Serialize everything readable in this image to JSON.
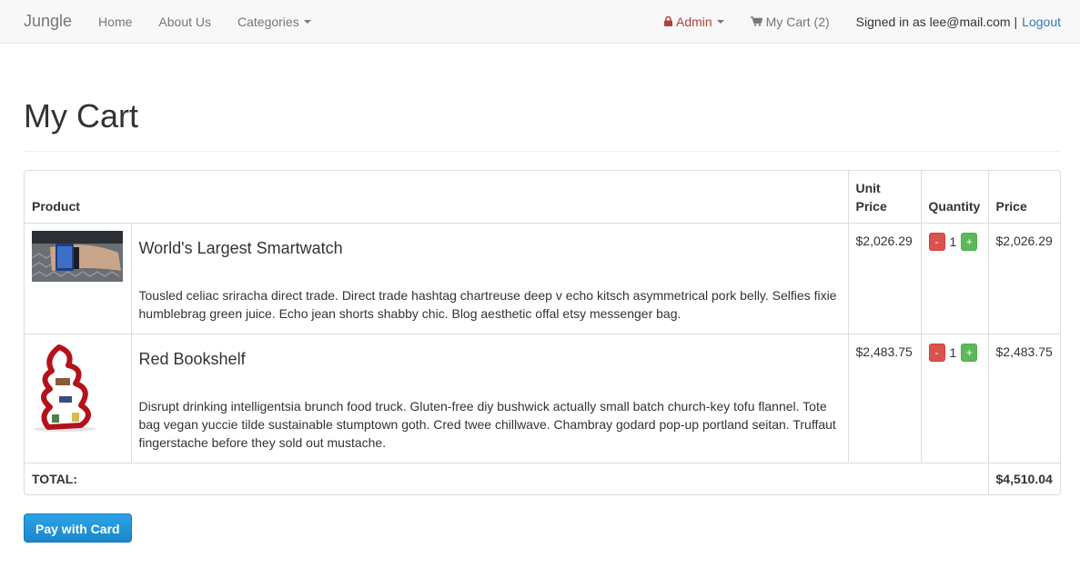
{
  "nav": {
    "brand": "Jungle",
    "home": "Home",
    "about": "About Us",
    "categories": "Categories",
    "admin": "Admin",
    "cart": "My Cart (2)",
    "signed_in": "Signed in as lee@mail.com",
    "separator": "|",
    "logout": "Logout"
  },
  "page": {
    "title": "My Cart"
  },
  "table": {
    "headers": {
      "product": "Product",
      "unit_price": "Unit Price",
      "quantity": "Quantity",
      "price": "Price"
    },
    "items": [
      {
        "name": "World's Largest Smartwatch",
        "description": "Tousled celiac sriracha direct trade. Direct trade hashtag chartreuse deep v echo kitsch asymmetrical pork belly. Selfies fixie humblebrag green juice. Echo jean shorts shabby chic. Blog aesthetic offal etsy messenger bag.",
        "unit_price": "$2,026.29",
        "quantity": "1",
        "price": "$2,026.29",
        "minus": "-",
        "plus": "+"
      },
      {
        "name": "Red Bookshelf",
        "description": "Disrupt drinking intelligentsia brunch food truck. Gluten-free diy bushwick actually small batch church-key tofu flannel. Tote bag vegan yuccie tilde sustainable stumptown goth. Cred twee chillwave. Chambray godard pop-up portland seitan. Truffaut fingerstache before they sold out mustache.",
        "unit_price": "$2,483.75",
        "quantity": "1",
        "price": "$2,483.75",
        "minus": "-",
        "plus": "+"
      }
    ],
    "total_label": "TOTAL:",
    "total_value": "$4,510.04"
  },
  "actions": {
    "pay": "Pay with Card"
  },
  "colors": {
    "accent": "#337ab7",
    "danger": "#d9534f",
    "success": "#5cb85c",
    "admin": "#a94442"
  }
}
